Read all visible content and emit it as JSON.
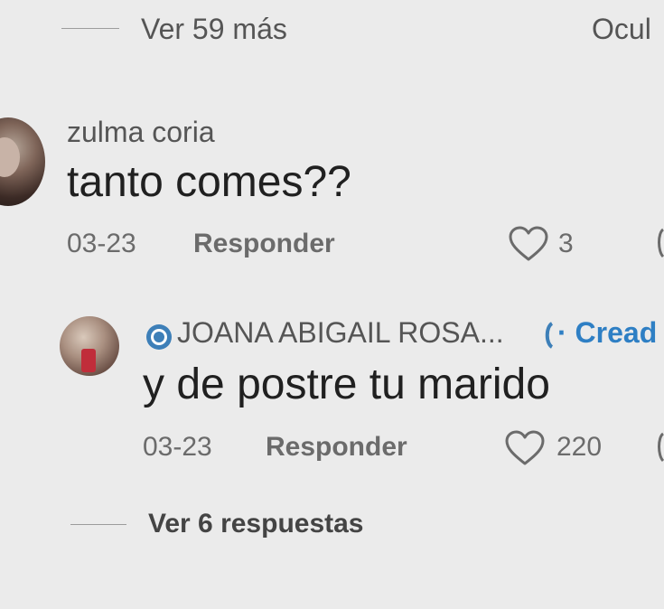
{
  "top_bar": {
    "view_more_label": "Ver 59 más",
    "hide_label": "Ocul"
  },
  "comments": [
    {
      "username": "zulma coria",
      "text": "tanto comes??",
      "date": "03-23",
      "reply_label": "Responder",
      "likes": "3"
    }
  ],
  "reply": {
    "username": "JOANA ABIGAIL ROSA...",
    "creator_tag": "· Cread",
    "text": "y de postre tu marido",
    "date": "03-23",
    "reply_label": "Responder",
    "likes": "220"
  },
  "footer": {
    "view_replies_label": "Ver 6 respuestas"
  },
  "colors": {
    "background": "#ebebeb",
    "creator_accent": "#2e7fc4",
    "muted_text": "#6b6b6b"
  },
  "icons": {
    "like": "heart-outline-icon",
    "verified": "verified-badge-icon"
  }
}
